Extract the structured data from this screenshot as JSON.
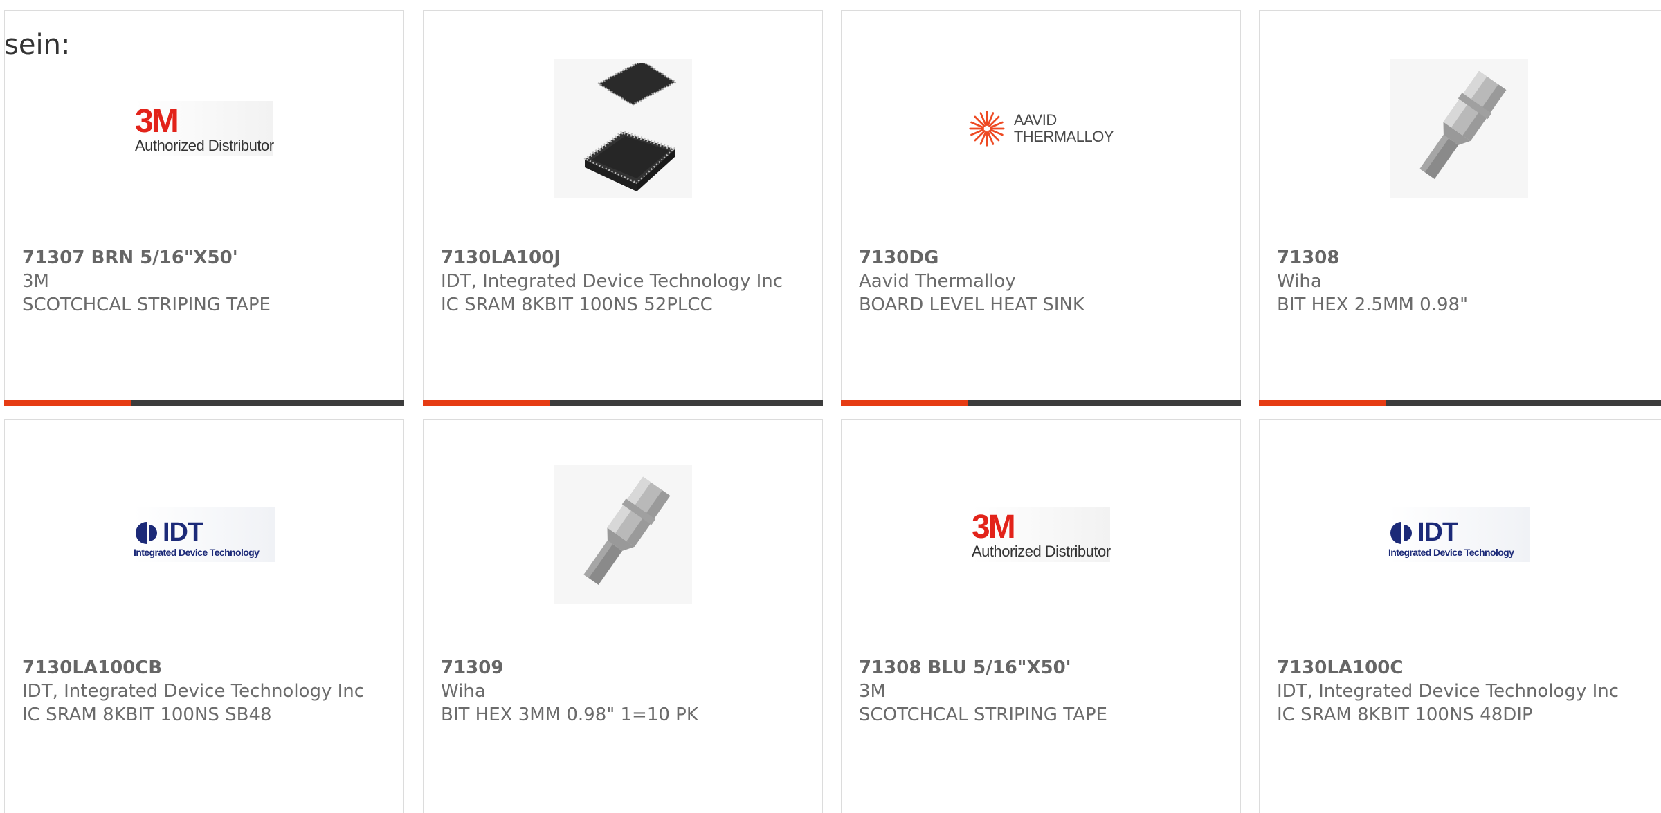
{
  "overlay_text": "sein:",
  "products": [
    {
      "part": "71307 BRN 5/16\"X50'",
      "manufacturer": "3M",
      "description": "SCOTCHCAL STRIPING TAPE",
      "image": "3m-logo"
    },
    {
      "part": "7130LA100J",
      "manufacturer": "IDT, Integrated Device Technology Inc",
      "description": "IC SRAM 8KBIT 100NS 52PLCC",
      "image": "plcc-chip-photo"
    },
    {
      "part": "7130DG",
      "manufacturer": "Aavid Thermalloy",
      "description": "BOARD LEVEL HEAT SINK",
      "image": "aavid-thermalloy-logo"
    },
    {
      "part": "71308",
      "manufacturer": "Wiha",
      "description": "BIT HEX 2.5MM 0.98\"",
      "image": "hex-bit-photo"
    },
    {
      "part": "7130LA100CB",
      "manufacturer": "IDT, Integrated Device Technology Inc",
      "description": "IC SRAM 8KBIT 100NS SB48",
      "image": "idt-logo"
    },
    {
      "part": "71309",
      "manufacturer": "Wiha",
      "description": "BIT HEX 3MM 0.98\" 1=10 PK",
      "image": "hex-bit-photo"
    },
    {
      "part": "71308 BLU 5/16\"X50'",
      "manufacturer": "3M",
      "description": "SCOTCHCAL STRIPING TAPE",
      "image": "3m-logo"
    },
    {
      "part": "7130LA100C",
      "manufacturer": "IDT, Integrated Device Technology Inc",
      "description": "IC SRAM 8KBIT 100NS 48DIP",
      "image": "idt-logo"
    }
  ],
  "logos": {
    "three_m": {
      "big": "3M",
      "small": "Authorized Distributor"
    },
    "aavid": {
      "line1": "AAVID",
      "line2": "THERMALLOY"
    },
    "idt": {
      "word": "IDT",
      "sub": "Integrated Device Technology"
    }
  },
  "colors": {
    "accent": "#e63c14",
    "bar": "#3c3c3c",
    "brand_3m": "#e2231a",
    "brand_idt": "#1c2a78",
    "brand_aavid": "#ee4a23"
  }
}
